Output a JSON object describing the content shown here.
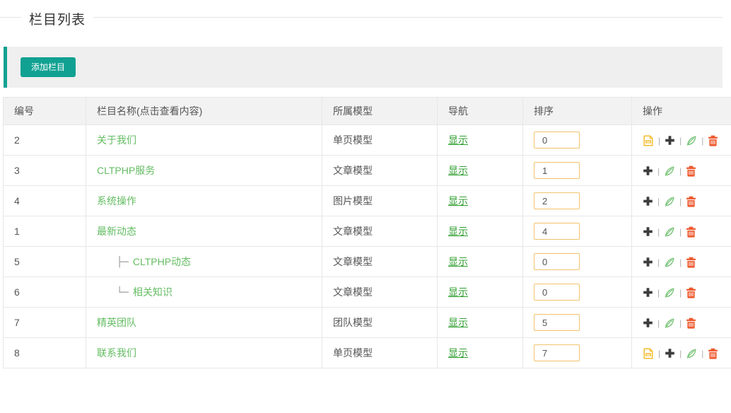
{
  "page": {
    "title": "栏目列表"
  },
  "toolbar": {
    "add_button_label": "添加栏目"
  },
  "colors": {
    "accent_teal": "#11a192",
    "toolbar_gray": "#efefef",
    "header_gray": "#f2f2f2",
    "border_gray": "#e7e7e7",
    "name_link_green": "#64bd63",
    "nav_link_green": "#2e9e2e",
    "sort_input_border": "#f2c36b",
    "doc_icon_amber": "#f3bc2e",
    "plus_icon_dark": "#3c3c3c",
    "pencil_icon_green": "#79c479",
    "trash_icon_red": "#ee5b31"
  },
  "table": {
    "headers": [
      "编号",
      "栏目名称(点击查看内容)",
      "所属模型",
      "导航",
      "排序",
      "操作"
    ],
    "icon_names": [
      "document-icon",
      "plus-icon",
      "pencil-icon",
      "trash-icon"
    ],
    "rows": [
      {
        "id": "2",
        "prefix": "",
        "name": "关于我们",
        "model": "单页模型",
        "nav": "显示",
        "sort": "0",
        "has_doc": true
      },
      {
        "id": "3",
        "prefix": "",
        "name": "CLTPHP服务",
        "model": "文章模型",
        "nav": "显示",
        "sort": "1",
        "has_doc": false
      },
      {
        "id": "4",
        "prefix": "",
        "name": "系统操作",
        "model": "图片模型",
        "nav": "显示",
        "sort": "2",
        "has_doc": false
      },
      {
        "id": "1",
        "prefix": "",
        "name": "最新动态",
        "model": "文章模型",
        "nav": "显示",
        "sort": "4",
        "has_doc": false
      },
      {
        "id": "5",
        "prefix": "├─",
        "name": "CLTPHP动态",
        "model": "文章模型",
        "nav": "显示",
        "sort": "0",
        "has_doc": false
      },
      {
        "id": "6",
        "prefix": "└─",
        "name": "相关知识",
        "model": "文章模型",
        "nav": "显示",
        "sort": "0",
        "has_doc": false
      },
      {
        "id": "7",
        "prefix": "",
        "name": "精英团队",
        "model": "团队模型",
        "nav": "显示",
        "sort": "5",
        "has_doc": false
      },
      {
        "id": "8",
        "prefix": "",
        "name": "联系我们",
        "model": "单页模型",
        "nav": "显示",
        "sort": "7",
        "has_doc": true
      }
    ]
  }
}
